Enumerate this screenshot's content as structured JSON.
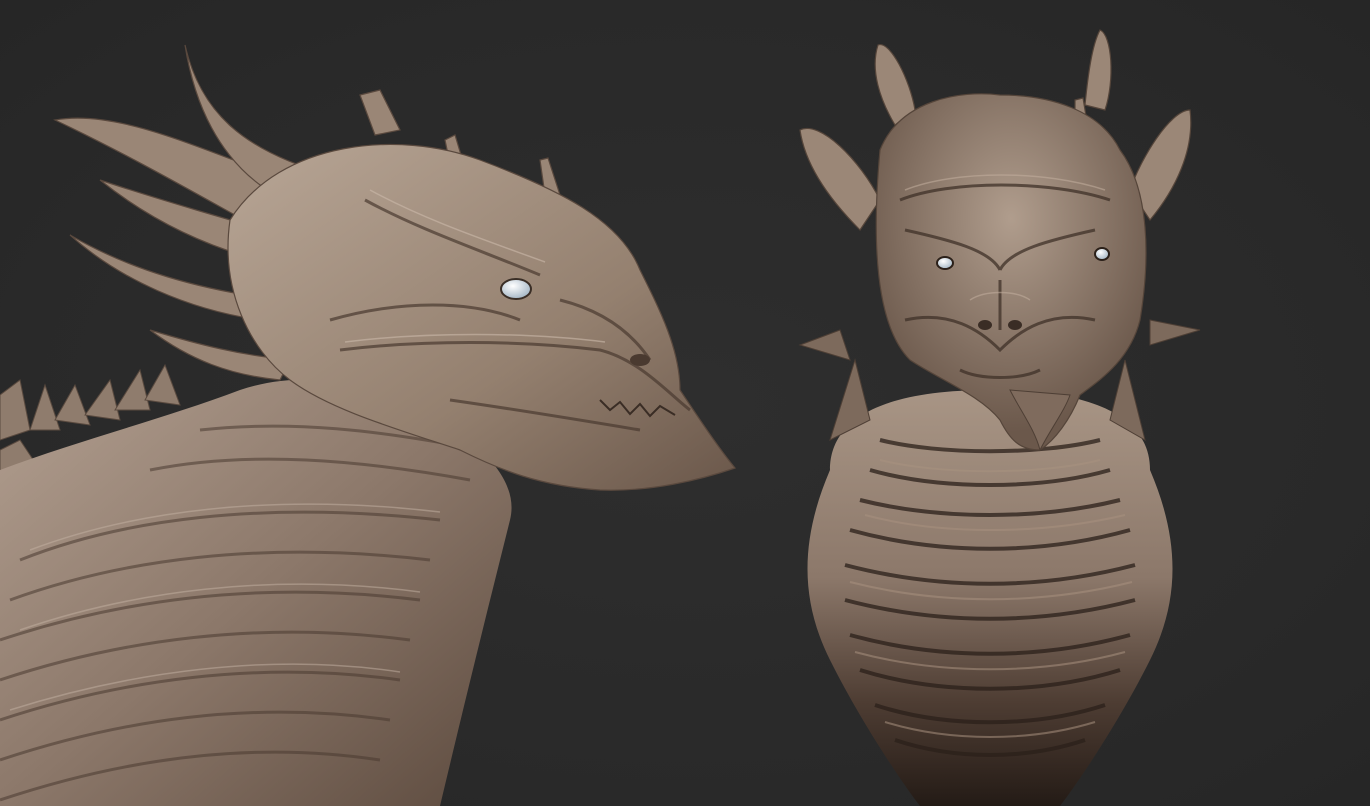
{
  "scene": {
    "background_color": "#2a2a2a",
    "clay_color": "#8e7b6d",
    "clay_highlight": "#c6b3a3",
    "clay_shadow": "#3a2d25",
    "eye_color": "#cdd8e0",
    "views": [
      {
        "name": "side-profile-view",
        "subject": "dragon-head-side"
      },
      {
        "name": "front-view",
        "subject": "dragon-head-front"
      }
    ]
  }
}
